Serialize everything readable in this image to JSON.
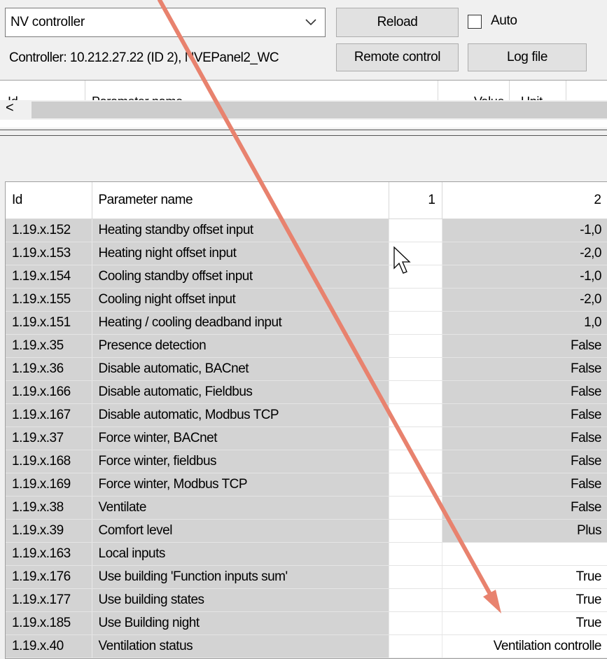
{
  "toolbar": {
    "combo_value": "NV controller",
    "reload_label": "Reload",
    "auto_label": "Auto",
    "remote_label": "Remote control",
    "log_label": "Log file",
    "controller_info": "Controller: 10.212.27.22 (ID 2), NVEPanel2_WC"
  },
  "top_grid": {
    "headers": [
      "Id",
      "Parameter name",
      "Value",
      "Unit"
    ],
    "scroll_left_glyph": "<"
  },
  "grid": {
    "headers": [
      "Id",
      "Parameter name",
      "1",
      "2"
    ],
    "rows": [
      {
        "id": "1.19.x.152",
        "name": "Heating standby offset input",
        "v1": "",
        "v2": "-1,0"
      },
      {
        "id": "1.19.x.153",
        "name": "Heating night offset input",
        "v1": "",
        "v2": "-2,0"
      },
      {
        "id": "1.19.x.154",
        "name": "Cooling standby offset input",
        "v1": "",
        "v2": "-1,0"
      },
      {
        "id": "1.19.x.155",
        "name": "Cooling night offset input",
        "v1": "",
        "v2": "-2,0"
      },
      {
        "id": "1.19.x.151",
        "name": "Heating / cooling deadband input",
        "v1": "",
        "v2": "1,0"
      },
      {
        "id": "1.19.x.35",
        "name": "Presence detection",
        "v1": "",
        "v2": "False"
      },
      {
        "id": "1.19.x.36",
        "name": "Disable automatic, BACnet",
        "v1": "",
        "v2": "False"
      },
      {
        "id": "1.19.x.166",
        "name": "Disable automatic, Fieldbus",
        "v1": "",
        "v2": "False"
      },
      {
        "id": "1.19.x.167",
        "name": "Disable automatic, Modbus TCP",
        "v1": "",
        "v2": "False"
      },
      {
        "id": "1.19.x.37",
        "name": "Force winter, BACnet",
        "v1": "",
        "v2": "False"
      },
      {
        "id": "1.19.x.168",
        "name": "Force winter, fieldbus",
        "v1": "",
        "v2": "False"
      },
      {
        "id": "1.19.x.169",
        "name": "Force winter, Modbus TCP",
        "v1": "",
        "v2": "False"
      },
      {
        "id": "1.19.x.38",
        "name": "Ventilate",
        "v1": "",
        "v2": "False"
      },
      {
        "id": "1.19.x.39",
        "name": "Comfort level",
        "v1": "",
        "v2": "Plus"
      },
      {
        "id": "1.19.x.163",
        "name": "Local inputs",
        "v1": "",
        "v2": ""
      },
      {
        "id": "1.19.x.176",
        "name": "Use building 'Function inputs sum'",
        "v1": "",
        "v2": "True"
      },
      {
        "id": "1.19.x.177",
        "name": "Use building states",
        "v1": "",
        "v2": "True"
      },
      {
        "id": "1.19.x.185",
        "name": "Use Building night",
        "v1": "",
        "v2": "True"
      },
      {
        "id": "1.19.x.40",
        "name": "Ventilation status",
        "v1": "",
        "v2": "Ventilation controlle"
      }
    ]
  },
  "colors": {
    "annotation_arrow": "#e8826e",
    "cell_gray": "#d3d3d3"
  }
}
